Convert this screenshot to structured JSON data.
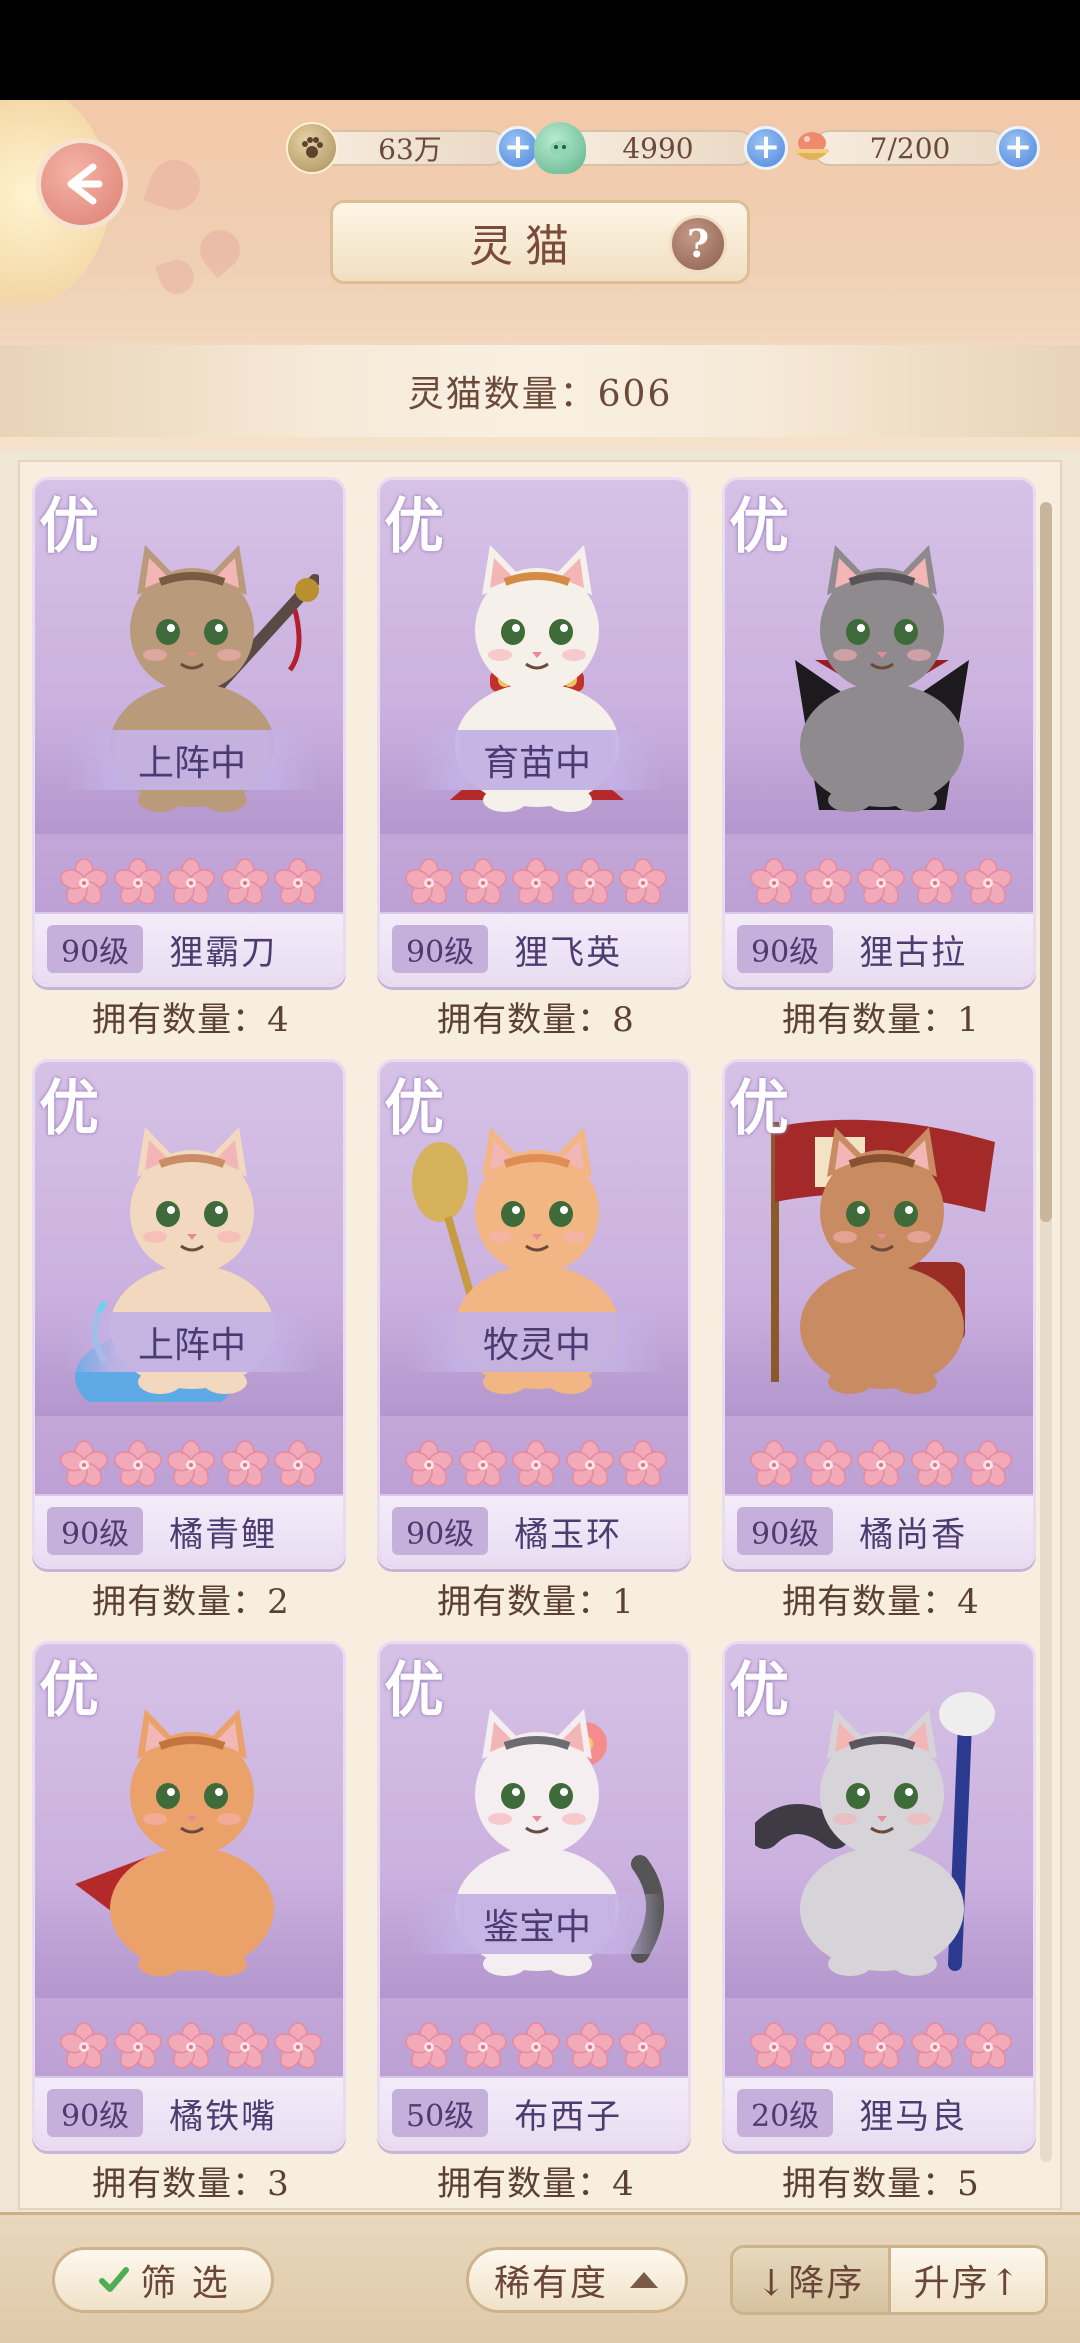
{
  "header": {
    "title": "灵猫",
    "help_label": "?",
    "cat_count_text": "灵猫数量：606"
  },
  "currencies": [
    {
      "icon": "paw-coin-icon",
      "value": "63万",
      "plus": "+"
    },
    {
      "icon": "jade-icon",
      "value": "4990",
      "plus": "+"
    },
    {
      "icon": "food-bowl-icon",
      "value": "7/200",
      "plus": "+"
    }
  ],
  "cats": [
    {
      "rarity": "优",
      "status": "上阵中",
      "level": "90级",
      "name": "狸霸刀",
      "owned": "拥有数量：4",
      "coat": "#b99a7a",
      "accent": "#7b5a44",
      "prop": "sword"
    },
    {
      "rarity": "优",
      "status": "育苗中",
      "level": "90级",
      "name": "狸飞英",
      "owned": "拥有数量：8",
      "coat": "#f6f0ea",
      "accent": "#d58a45",
      "prop": "cape"
    },
    {
      "rarity": "优",
      "status": "",
      "level": "90级",
      "name": "狸古拉",
      "owned": "拥有数量：1",
      "coat": "#8e8a8e",
      "accent": "#5a5358",
      "prop": "vampire"
    },
    {
      "rarity": "优",
      "status": "上阵中",
      "level": "90级",
      "name": "橘青鲤",
      "owned": "拥有数量：2",
      "coat": "#f3d8c0",
      "accent": "#c98e66",
      "prop": "tail"
    },
    {
      "rarity": "优",
      "status": "牧灵中",
      "level": "90级",
      "name": "橘玉环",
      "owned": "拥有数量：1",
      "coat": "#f2b684",
      "accent": "#e08c55",
      "prop": "mirror"
    },
    {
      "rarity": "优",
      "status": "",
      "level": "90级",
      "name": "橘尚香",
      "owned": "拥有数量：4",
      "coat": "#c98b61",
      "accent": "#8a5130",
      "prop": "flag"
    },
    {
      "rarity": "优",
      "status": "",
      "level": "90级",
      "name": "橘铁嘴",
      "owned": "拥有数量：3",
      "coat": "#eaa26a",
      "accent": "#c4753f",
      "prop": "fan"
    },
    {
      "rarity": "优",
      "status": "鉴宝中",
      "level": "50级",
      "name": "布西子",
      "owned": "拥有数量：4",
      "coat": "#f4eef0",
      "accent": "#6e6a72",
      "prop": "flower"
    },
    {
      "rarity": "优",
      "status": "",
      "level": "20级",
      "name": "狸马良",
      "owned": "拥有数量：5",
      "coat": "#d6d4d8",
      "accent": "#5a5660",
      "prop": "brush"
    }
  ],
  "bottom": {
    "filter_label": "筛 选",
    "rarity_label": "稀有度",
    "desc_label": "↓降序",
    "asc_label": "升序↑"
  },
  "colors": {
    "card_purple": "#c8addd",
    "petal_pink": "#f2a9b8",
    "plus_blue": "#4d86dc",
    "text_brown": "#5b4036"
  }
}
